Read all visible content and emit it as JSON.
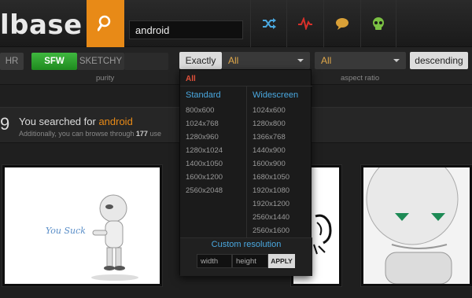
{
  "header": {
    "logo_text": "lbase",
    "search_value": "android"
  },
  "filters": {
    "purity_buttons": [
      "HR",
      "SFW",
      "SKETCHY"
    ],
    "purity_label": "purity",
    "exactly_label": "Exactly",
    "resolution_selected": "All",
    "aspect_selected": "All",
    "aspect_label": "aspect ratio",
    "sort_label": "descending"
  },
  "resolution_panel": {
    "all_label": "All",
    "standard_heading": "Standard",
    "widescreen_heading": "Widescreen",
    "standard": [
      "800x600",
      "1024x768",
      "1280x960",
      "1280x1024",
      "1400x1050",
      "1600x1200",
      "2560x2048"
    ],
    "widescreen": [
      "1024x600",
      "1280x800",
      "1366x768",
      "1440x900",
      "1600x900",
      "1680x1050",
      "1920x1080",
      "1920x1200",
      "2560x1440",
      "2560x1600"
    ],
    "custom_title": "Custom resolution",
    "width_placeholder": "width",
    "height_placeholder": "height",
    "apply_label": "APPLY"
  },
  "search_summary": {
    "count_fragment": "9",
    "text_prefix": "You searched for ",
    "query": "android",
    "additional_prefix": "Additionally, you can browse through ",
    "additional_count": "177",
    "additional_suffix": " use"
  },
  "thumbnails": [
    {
      "caption": "You Suck"
    }
  ],
  "colors": {
    "accent": "#e88a17",
    "sfw_green": "#2fa32f",
    "link_blue": "#4aa8e0",
    "all_red": "#e0503a"
  }
}
